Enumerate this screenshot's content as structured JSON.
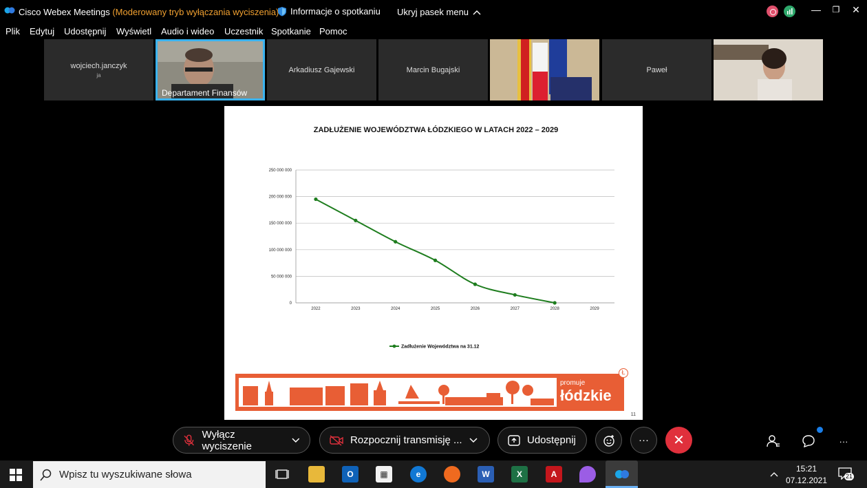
{
  "titlebar": {
    "app_name": "Cisco Webex Meetings",
    "mode_text": "(Moderowany tryb wyłączania wyciszenia)",
    "info_label": "Informacje o spotkaniu",
    "hide_menu_label": "Ukryj pasek menu",
    "minimize": "—",
    "restore": "❐",
    "close": "✕"
  },
  "menu": {
    "items": [
      "Plik",
      "Edytuj",
      "Udostępnij",
      "Wyświetl",
      "Audio i wideo",
      "Uczestnik",
      "Spotkanie",
      "Pomoc"
    ]
  },
  "participants": [
    {
      "name": "wojciech.janczyk",
      "sub": "ja"
    },
    {
      "name": "Departament Finansów"
    },
    {
      "name": "Arkadiusz Gajewski"
    },
    {
      "name": "Marcin Bugajski"
    },
    {
      "name": ""
    },
    {
      "name": "Paweł"
    },
    {
      "name": ""
    }
  ],
  "slide": {
    "page_number": "11",
    "banner_promo": "promuje",
    "banner_brand": "łódzkie",
    "banner_emblem": "Ł"
  },
  "chart_data": {
    "type": "line",
    "title": "ZADŁUŻENIE WOJEWÓDZTWA ŁÓDZKIEGO W LATACH 2022 – 2029",
    "categories": [
      "2022",
      "2023",
      "2024",
      "2025",
      "2026",
      "2027",
      "2028",
      "2029"
    ],
    "series": [
      {
        "name": "Zadłużenie Województwa na 31.12",
        "values": [
          195000000,
          155000000,
          115000000,
          80000000,
          35000000,
          15000000,
          0,
          null
        ],
        "color": "#1e7d1e"
      }
    ],
    "ylim": [
      0,
      250000000
    ],
    "yticks": [
      "0",
      "50 000 000",
      "100 000 000",
      "150 000 000",
      "200 000 000",
      "250 000 000"
    ],
    "grid": true,
    "legend": "bottom"
  },
  "controls": {
    "mute_label": "Wyłącz wyciszenie",
    "stream_label": "Rozpocznij transmisję ...",
    "share_label": "Udostępnij",
    "more": "···",
    "end": "✕"
  },
  "taskbar": {
    "search_placeholder": "Wpisz tu wyszukiwane słowa",
    "time": "15:21",
    "date": "07.12.2021",
    "notif_count": "21"
  },
  "colors": {
    "accent_blue": "#3ab3f0",
    "end_red": "#e0303c",
    "mode_orange": "#f0a030",
    "banner_orange": "#e85e35"
  }
}
